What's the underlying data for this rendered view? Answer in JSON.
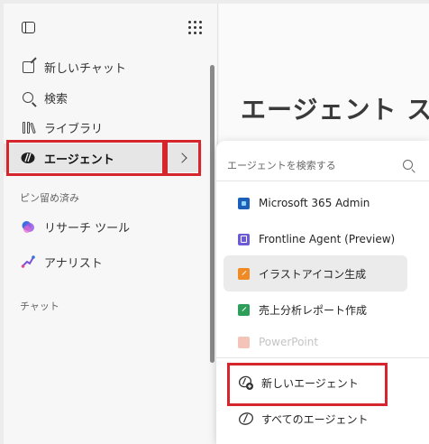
{
  "sidebar": {
    "nav": [
      {
        "label": "新しいチャット",
        "icon": "new-chat-icon"
      },
      {
        "label": "検索",
        "icon": "search-icon"
      },
      {
        "label": "ライブラリ",
        "icon": "library-icon"
      },
      {
        "label": "エージェント",
        "icon": "agent-icon"
      }
    ],
    "pinned_label": "ピン留め済み",
    "pinned": [
      {
        "label": "リサーチ ツール",
        "icon": "research-tool-icon"
      },
      {
        "label": "アナリスト",
        "icon": "analyst-icon"
      }
    ],
    "chat_label": "チャット"
  },
  "main": {
    "title": "エージェント ス"
  },
  "flyout": {
    "search_placeholder": "エージェントを検索する",
    "agents": [
      {
        "label": "Microsoft 365 Admin",
        "icon": "microsoft-365-admin-icon"
      },
      {
        "label": "Frontline Agent (Preview)",
        "icon": "frontline-agent-icon"
      },
      {
        "label": "イラストアイコン生成",
        "icon": "illustration-icon"
      },
      {
        "label": "売上分析レポート作成",
        "icon": "sales-report-icon"
      },
      {
        "label": "PowerPoint",
        "icon": "powerpoint-icon"
      }
    ],
    "new_agent": "新しいエージェント",
    "all_agents": "すべてのエージェント"
  },
  "colors": {
    "highlight": "#d6262d",
    "active_bg": "#e6e6e6"
  }
}
